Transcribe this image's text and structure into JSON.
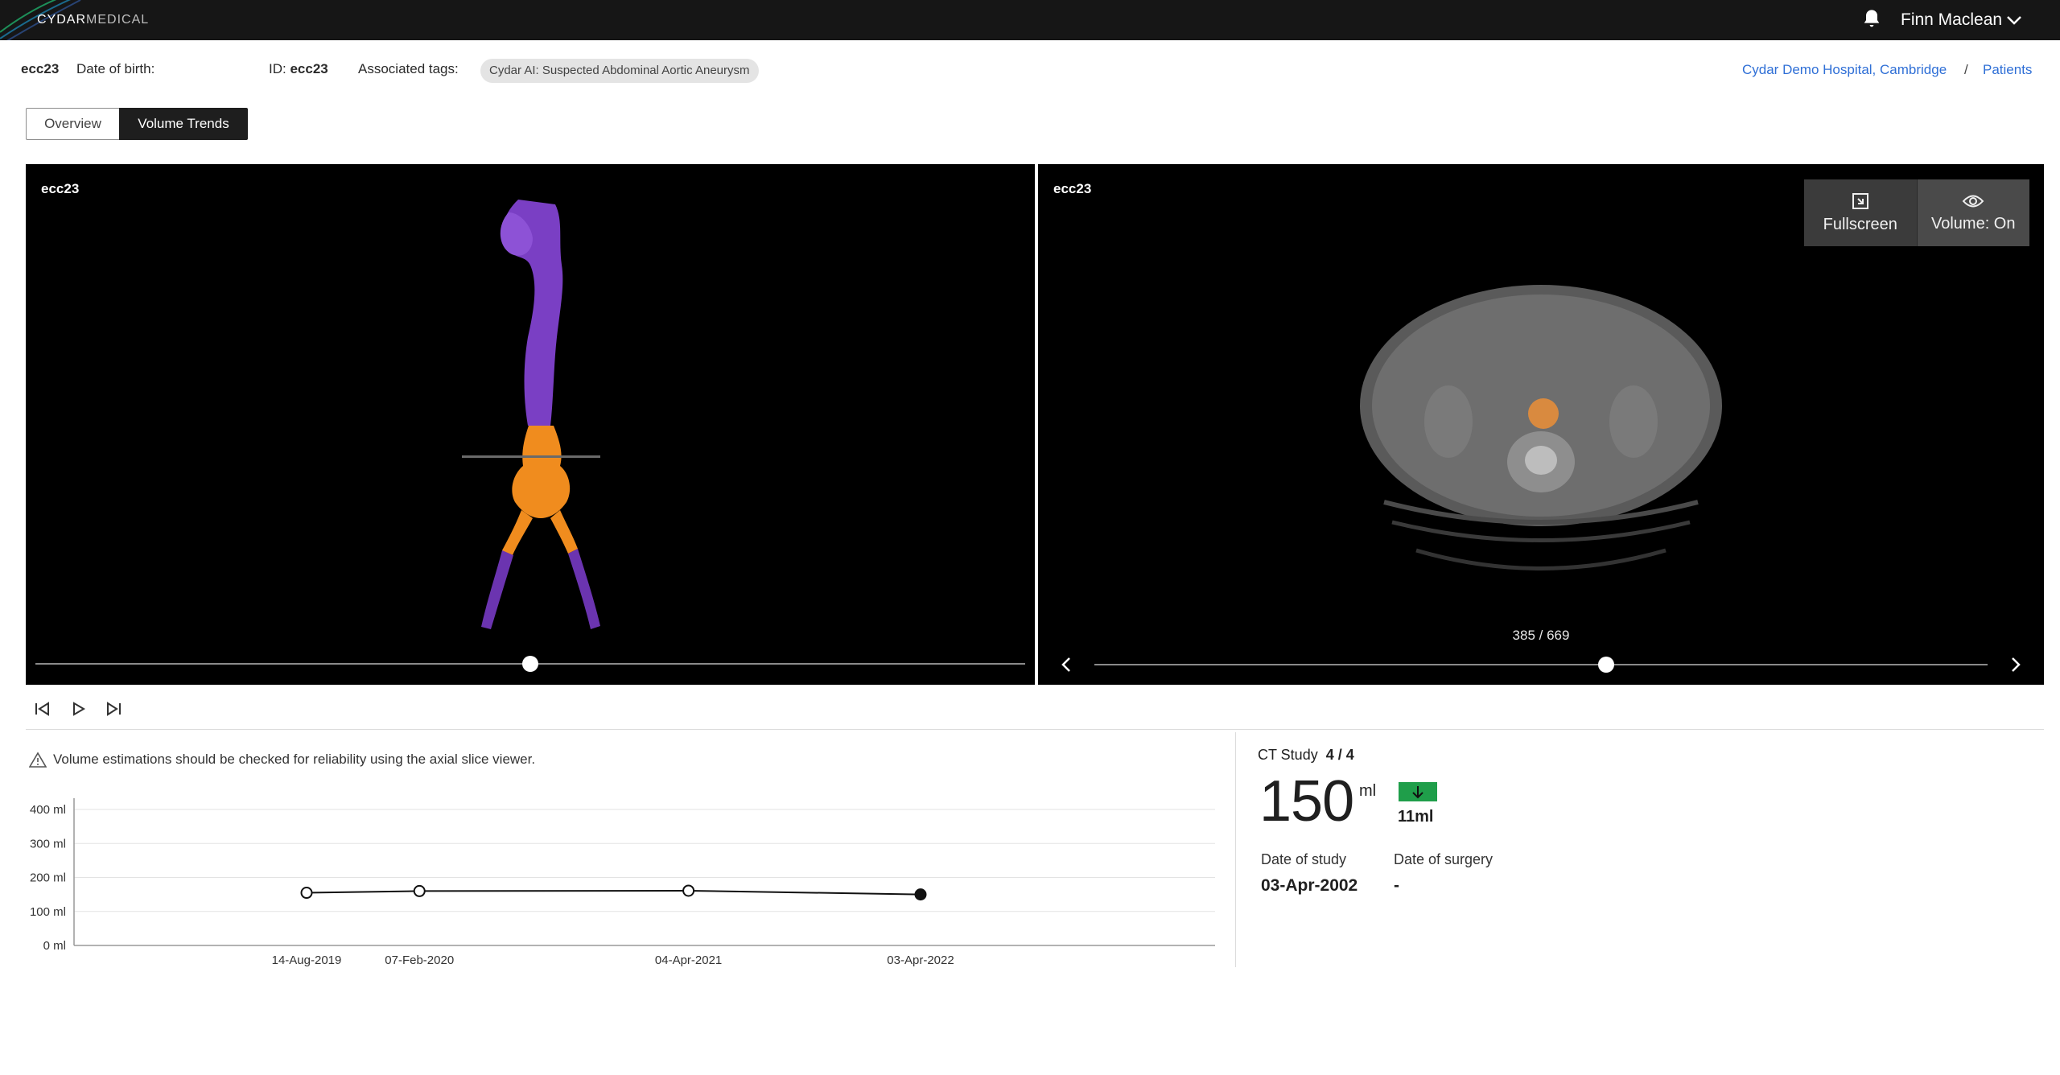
{
  "topbar": {
    "logo_bold": "CYDAR",
    "logo_light": "MEDICAL",
    "user_name": "Finn Maclean"
  },
  "patient": {
    "name": "ecc23",
    "dob_label": "Date of birth:",
    "id_label": "ID:",
    "id_value": "ecc23",
    "tags_label": "Associated tags:",
    "tag": "Cydar AI: Suspected Abdominal Aortic Aneurysm"
  },
  "breadcrumb": {
    "hospital": "Cydar Demo Hospital, Cambridge",
    "separator": "/",
    "patients": "Patients"
  },
  "tabs": {
    "overview": "Overview",
    "volume_trends": "Volume Trends",
    "active": "volume_trends"
  },
  "viewer_3d": {
    "label": "ecc23",
    "slider_position": 0.5
  },
  "viewer_axial": {
    "label": "ecc23",
    "slice_counter": "385 / 669",
    "slider_position": 0.575,
    "fullscreen_label": "Fullscreen",
    "volume_label": "Volume: On"
  },
  "warning": {
    "text": "Volume estimations should be checked for reliability using the axial slice viewer."
  },
  "chart_data": {
    "type": "line",
    "x": [
      "14-Aug-2019",
      "07-Feb-2020",
      "04-Apr-2021",
      "03-Apr-2022"
    ],
    "series": [
      {
        "values": [
          155,
          160,
          161,
          150
        ]
      }
    ],
    "y_tick_labels": [
      "400 ml",
      "300 ml",
      "200 ml",
      "100 ml",
      "0 ml"
    ],
    "ylim": [
      0,
      400
    ],
    "grid": true,
    "selected_point": "03-Apr-2022"
  },
  "stats": {
    "study_label": "CT Study",
    "study_value": "4 / 4",
    "volume": "150",
    "volume_unit": "ml",
    "delta": "11ml",
    "delta_direction": "down",
    "delta_color": "#1f9e4a",
    "date_of_study_label": "Date of study",
    "date_of_study": "03-Apr-2002",
    "date_of_surgery_label": "Date of surgery",
    "date_of_surgery": "-"
  }
}
